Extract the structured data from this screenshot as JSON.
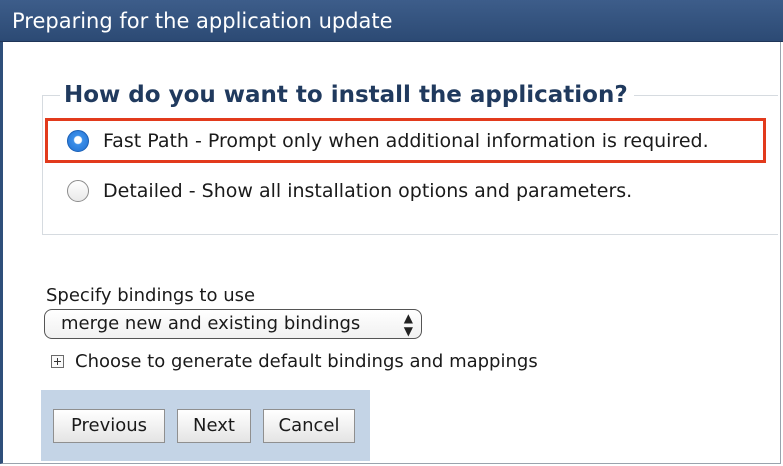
{
  "dialog": {
    "title": "Preparing for the application update"
  },
  "install_group": {
    "legend": "How do you want to install the application?",
    "options": [
      {
        "label": "Fast Path - Prompt only when additional information is required.",
        "selected": true
      },
      {
        "label": "Detailed - Show all installation options and parameters.",
        "selected": false
      }
    ]
  },
  "bindings": {
    "label": "Specify bindings to use",
    "selected_value": "merge new and existing bindings"
  },
  "defaults_toggle": {
    "label": "Choose to generate default bindings and mappings",
    "icon": "plus-expand-icon"
  },
  "buttons": {
    "previous": "Previous",
    "next": "Next",
    "cancel": "Cancel"
  },
  "colors": {
    "title_bar": "#2f4f7a",
    "legend_text": "#203a5e",
    "highlight_border": "#e23a1c",
    "button_bar": "#c4d4e6",
    "radio_selected": "#1f6fd2"
  }
}
